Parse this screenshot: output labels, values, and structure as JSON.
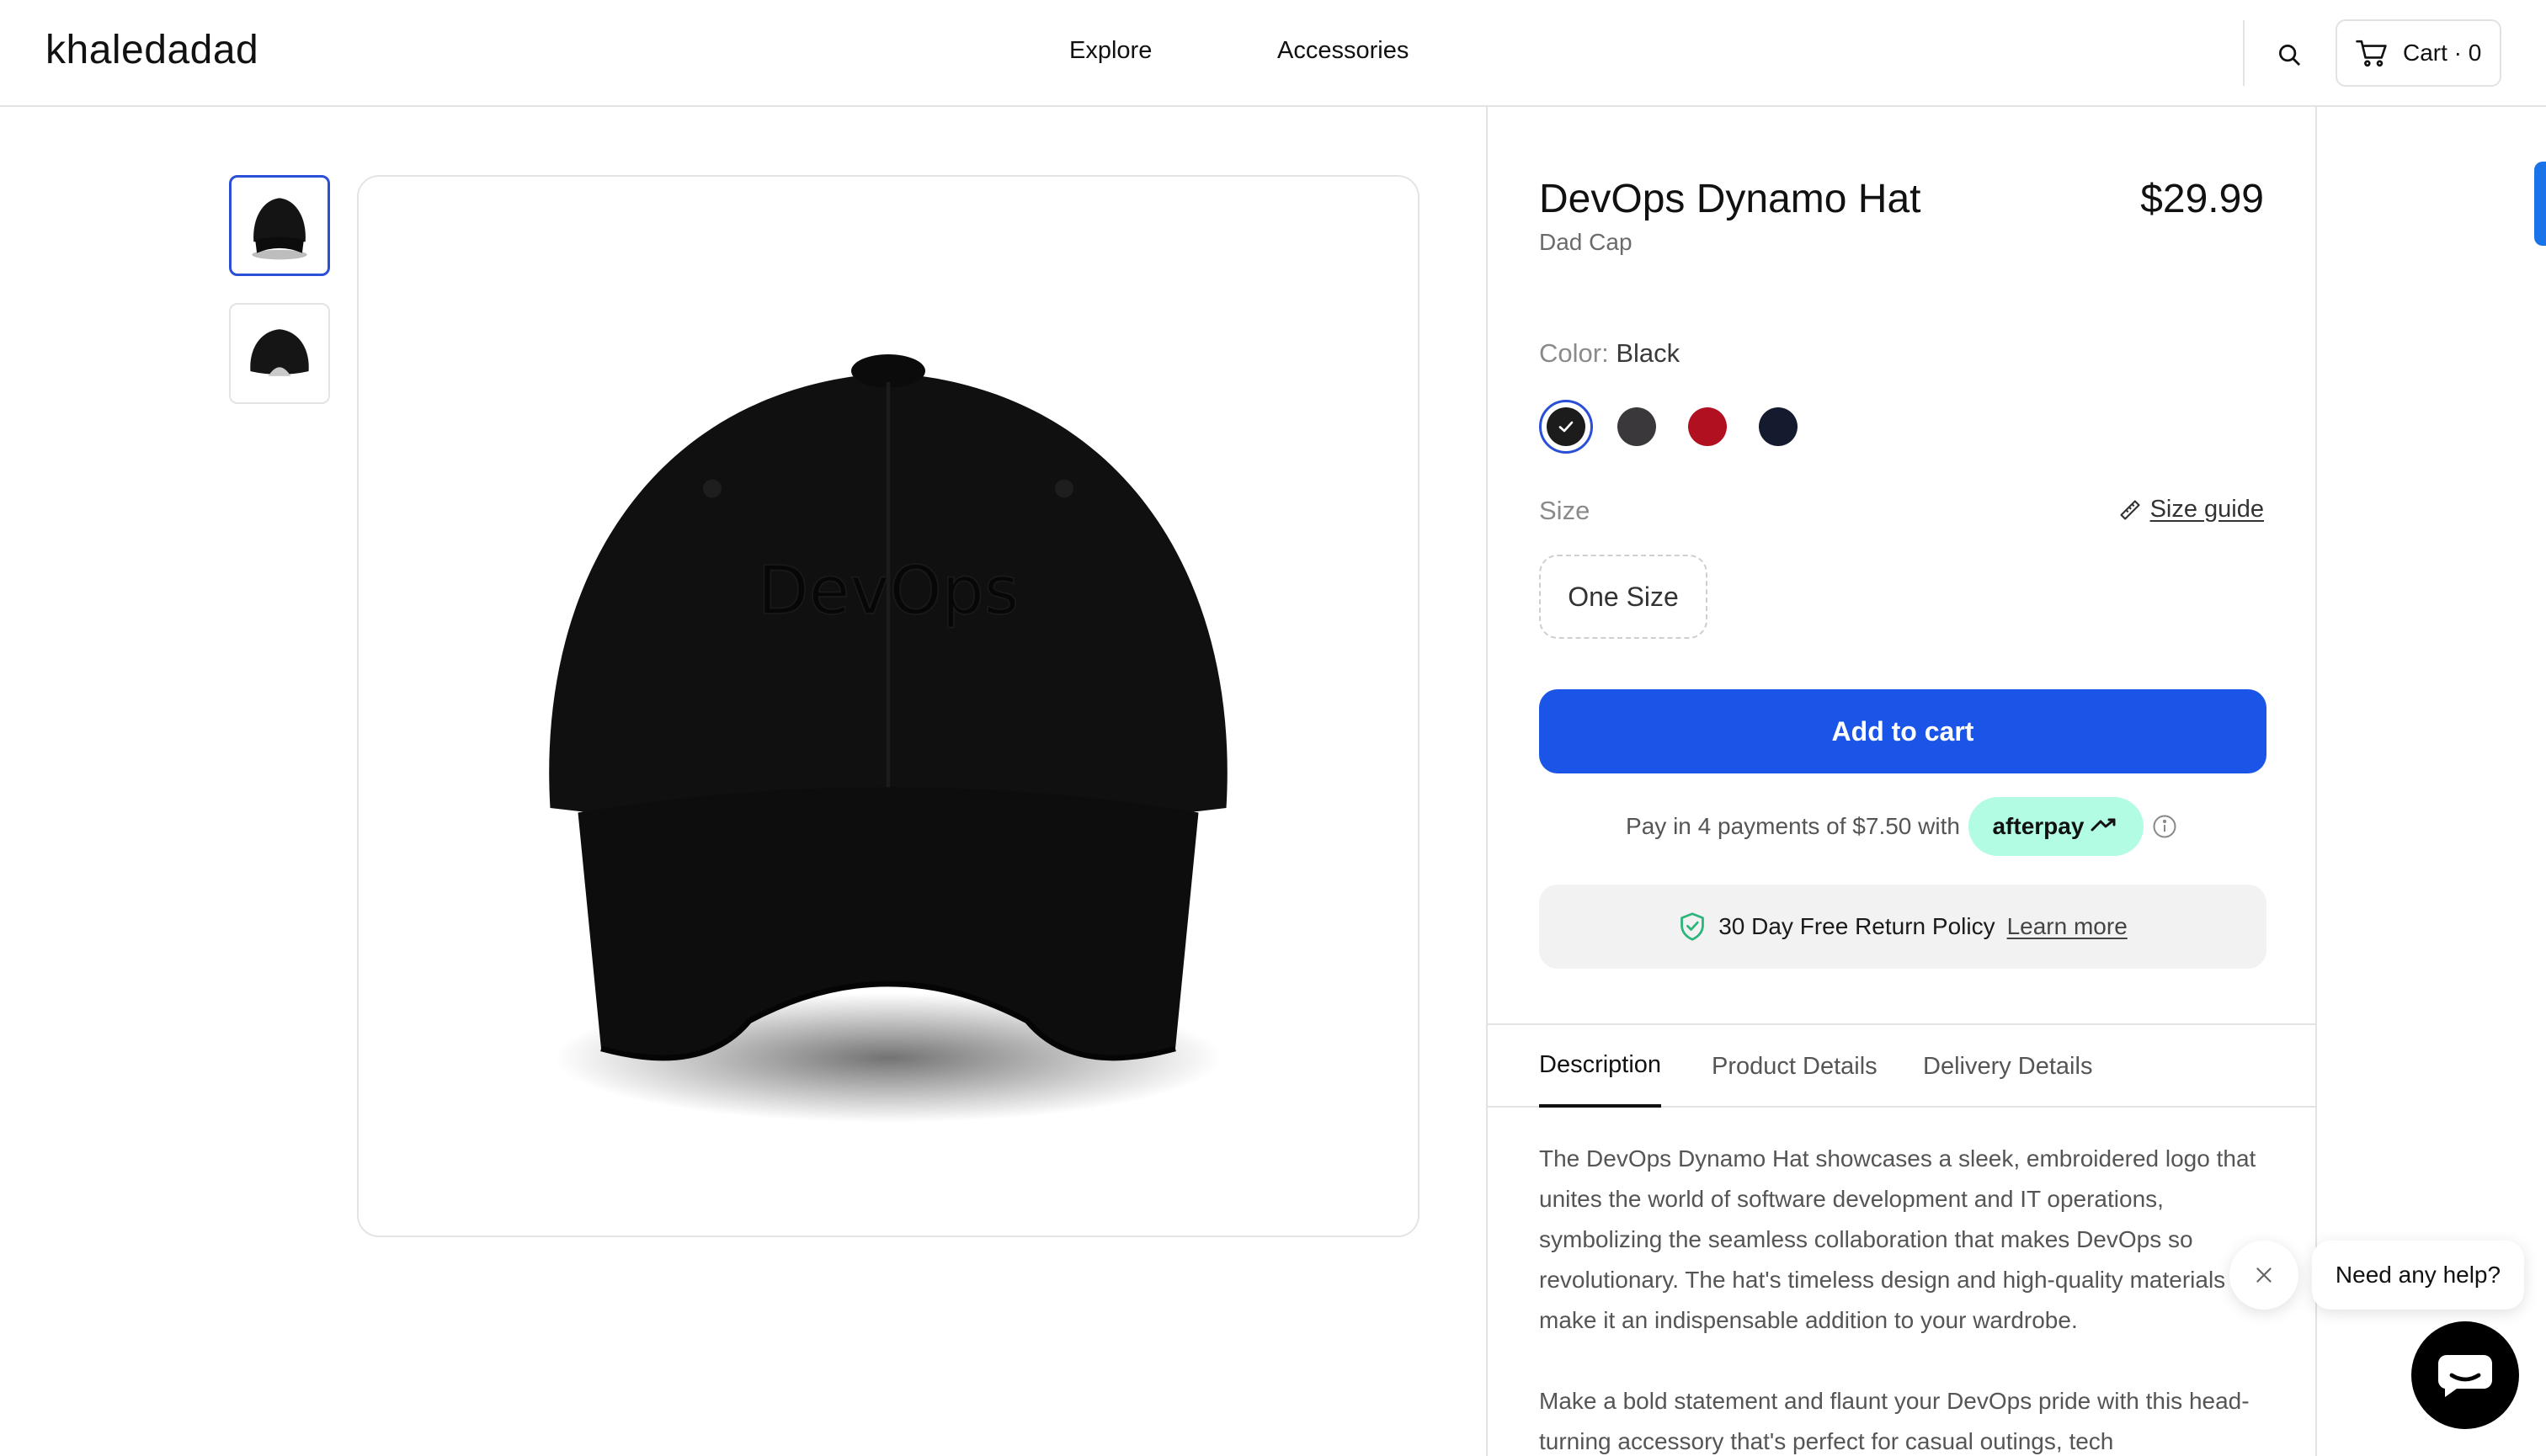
{
  "header": {
    "logo": "khaledadad",
    "nav": [
      {
        "label": "Explore"
      },
      {
        "label": "Accessories"
      }
    ],
    "cart_label": "Cart · 0"
  },
  "gallery": {
    "thumbnails": [
      {
        "view": "front",
        "selected": true
      },
      {
        "view": "back",
        "selected": false
      }
    ],
    "hat_embroidery": "DevOps"
  },
  "product": {
    "title": "DevOps Dynamo Hat",
    "subtitle": "Dad Cap",
    "price": "$29.99",
    "color_label": "Color:",
    "color_value": "Black",
    "swatches": [
      {
        "color": "#1c1c1c",
        "selected": true
      },
      {
        "color": "#3b383c",
        "selected": false
      },
      {
        "color": "#b01020",
        "selected": false
      },
      {
        "color": "#141b2e",
        "selected": false
      }
    ],
    "size_label": "Size",
    "size_guide": "Size guide",
    "size_option": "One Size",
    "add_to_cart": "Add to cart",
    "pay_text": "Pay in 4 payments of $7.50 with",
    "afterpay_label": "afterpay",
    "return_text": "30 Day Free Return Policy",
    "learn_more": "Learn more"
  },
  "tabs": [
    {
      "label": "Description",
      "active": true
    },
    {
      "label": "Product Details",
      "active": false
    },
    {
      "label": "Delivery Details",
      "active": false
    }
  ],
  "description": {
    "p1": "The DevOps Dynamo Hat showcases a sleek, embroidered logo that unites the world of software development and IT operations, symbolizing the seamless collaboration that makes DevOps so revolutionary. The hat's timeless design and high-quality materials make it an indispensable addition to your wardrobe.",
    "p2": "Make a bold statement and flaunt your DevOps pride with this head-turning accessory that's perfect for casual outings, tech"
  },
  "help_widget": {
    "bubble_text": "Need any help?"
  },
  "colors": {
    "accent": "#1a55e8",
    "selection": "#2b4fd6",
    "afterpay": "#b2fce4",
    "shield": "#2bb57a"
  }
}
